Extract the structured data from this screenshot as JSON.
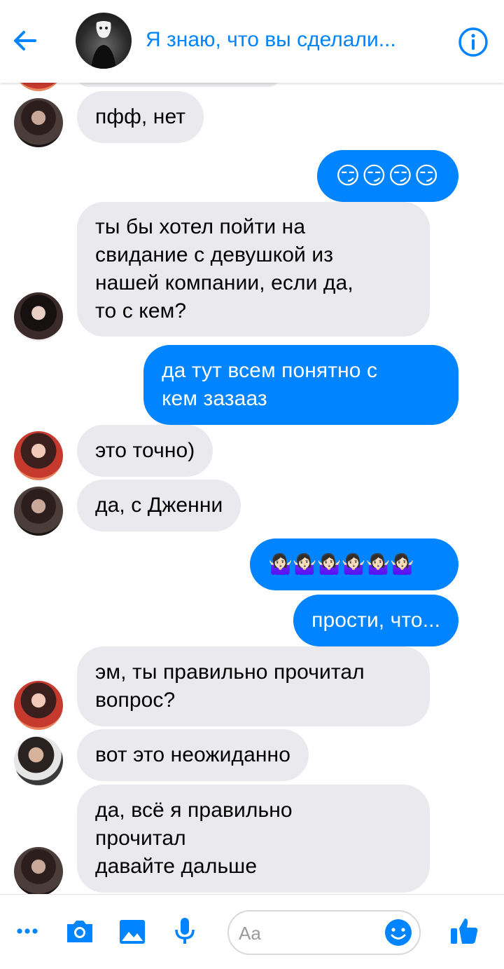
{
  "header": {
    "title": "Я знаю, что вы сделали...",
    "back_icon": "arrow-left-icon",
    "info_icon": "info-icon",
    "accent_color": "#0084ff"
  },
  "messages": [
    {
      "side": "in",
      "avatar": "a",
      "text": "пфф, нет"
    },
    {
      "side": "out",
      "text": "😏😏😏😏"
    },
    {
      "side": "in",
      "avatar": "b",
      "text": "ты бы хотел пойти на\nсвидание с девушкой из\nнашей компании, если да,\nто с кем?"
    },
    {
      "side": "out",
      "text": "да тут всем понятно с\nкем зазааз"
    },
    {
      "side": "in",
      "avatar": "c",
      "text": "это точно)"
    },
    {
      "side": "in",
      "avatar": "a",
      "text": "да, с Дженни"
    },
    {
      "side": "out",
      "text": "🤷🏻‍♀️🤷🏻‍♀️🤷🏻‍♀️🤷🏻‍♀️🤷🏻‍♀️🤷🏻‍♀️"
    },
    {
      "side": "out",
      "text": "прости, что..."
    },
    {
      "side": "in",
      "avatar": "c",
      "text": "эм, ты правильно прочитал\nвопрос?"
    },
    {
      "side": "in",
      "avatar": "d",
      "text": "вот это неожиданно"
    },
    {
      "side": "in",
      "avatar": "a",
      "text": "да, всё я правильно\nпрочитал\nдавайте дальше"
    }
  ],
  "composer": {
    "placeholder": "Aa",
    "icons": [
      "more-icon",
      "camera-icon",
      "gallery-icon",
      "microphone-icon",
      "emoji-icon",
      "like-icon"
    ]
  }
}
